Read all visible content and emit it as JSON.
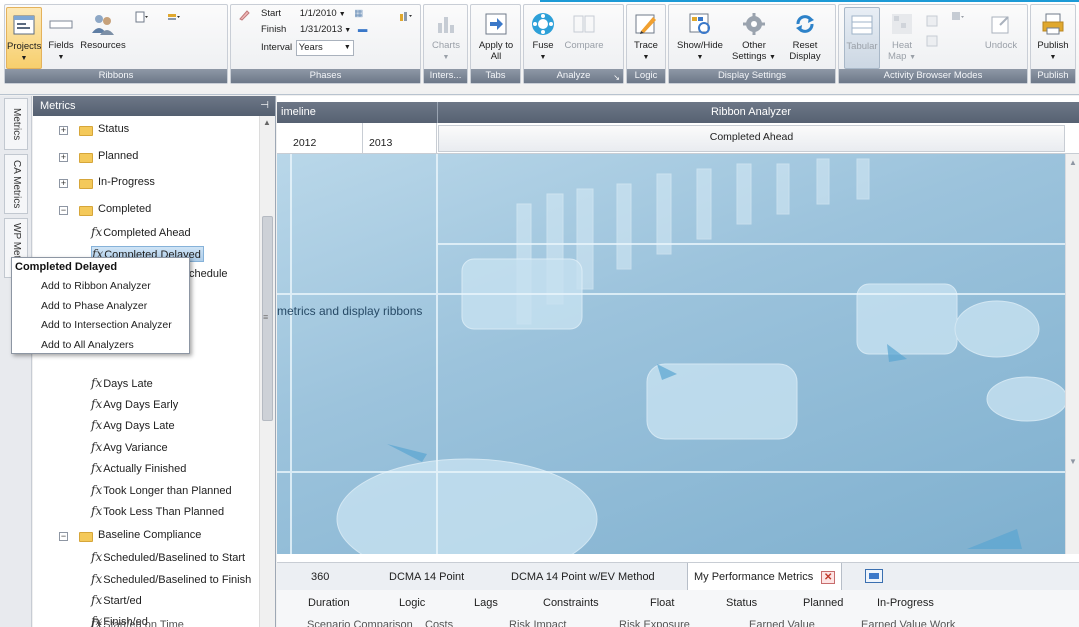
{
  "ribbon": {
    "groups": {
      "ribbons": {
        "title": "Ribbons",
        "projects": "Projects",
        "fields": "Fields",
        "resources": "Resources"
      },
      "phases": {
        "title": "Phases",
        "start_label": "Start",
        "start_value": "1/1/2010",
        "finish_label": "Finish",
        "finish_value": "1/31/2013",
        "interval_label": "Interval",
        "interval_value": "Years"
      },
      "inters": {
        "title": "Inters...",
        "charts": "Charts"
      },
      "tabs": {
        "title": "Tabs",
        "apply_to_all_1": "Apply to",
        "apply_to_all_2": "All"
      },
      "analyze": {
        "title": "Analyze",
        "fuse": "Fuse",
        "compare": "Compare"
      },
      "logic": {
        "title": "Logic",
        "trace": "Trace"
      },
      "display": {
        "title": "Display Settings",
        "show_hide": "Show/Hide",
        "other_1": "Other",
        "other_2": "Settings",
        "reset_1": "Reset",
        "reset_2": "Display"
      },
      "modes": {
        "title": "Activity Browser Modes",
        "tabular": "Tabular",
        "heat_1": "Heat",
        "heat_2": "Map",
        "undock": "Undock"
      },
      "publish": {
        "title": "Publish",
        "publish": "Publish"
      }
    }
  },
  "side_tabs": [
    "Metrics",
    "CA Metrics",
    "WP Metrics"
  ],
  "metrics_panel": {
    "title": "Metrics",
    "tree": {
      "status": "Status",
      "planned": "Planned",
      "in_progress": "In-Progress",
      "completed": "Completed",
      "completed_ahead": "Completed Ahead",
      "completed_delayed": "Completed Delayed",
      "on_schedule_tail": "chedule",
      "days_late": "Days Late",
      "avg_days_early": "Avg Days Early",
      "avg_days_late": "Avg Days Late",
      "avg_variance": "Avg Variance",
      "actually_finished": "Actually Finished",
      "took_longer": "Took Longer than Planned",
      "took_less": "Took Less Than Planned",
      "baseline_compliance": "Baseline Compliance",
      "sched_start": "Scheduled/Baselined to Start",
      "sched_finish": "Scheduled/Baselined to Finish",
      "start_ed": "Start/ed",
      "finish_ed": "Finish/ed",
      "cut_item": "Start/ed on Time"
    }
  },
  "context_menu": {
    "title": "Completed Delayed",
    "items": [
      "Add to Ribbon Analyzer",
      "Add to Phase Analyzer",
      "Add to Intersection Analyzer",
      "Add to All Analyzers"
    ]
  },
  "main": {
    "timeline_header": "imeline",
    "analyzer_header": "Ribbon Analyzer",
    "years": [
      "2012",
      "2013"
    ],
    "column": "Completed Ahead",
    "placeholder": "metrics and display ribbons",
    "tabs": [
      "360",
      "DCMA 14 Point",
      "DCMA 14 Point w/EV Method",
      "My Performance Metrics"
    ],
    "metric_columns": [
      "Duration",
      "Logic",
      "Lags",
      "Constraints",
      "Float",
      "Status",
      "Planned",
      "In-Progress"
    ],
    "cut_columns": [
      "Scenario Comparison",
      "Costs",
      "Risk Impact",
      "Risk Exposure",
      "Earned Value",
      "Earned Value Work"
    ]
  },
  "colors": {
    "accent": "#1c9ad6",
    "header": "#5f6a7b",
    "folder": "#f4c95a",
    "highlight": "#aecde9"
  }
}
